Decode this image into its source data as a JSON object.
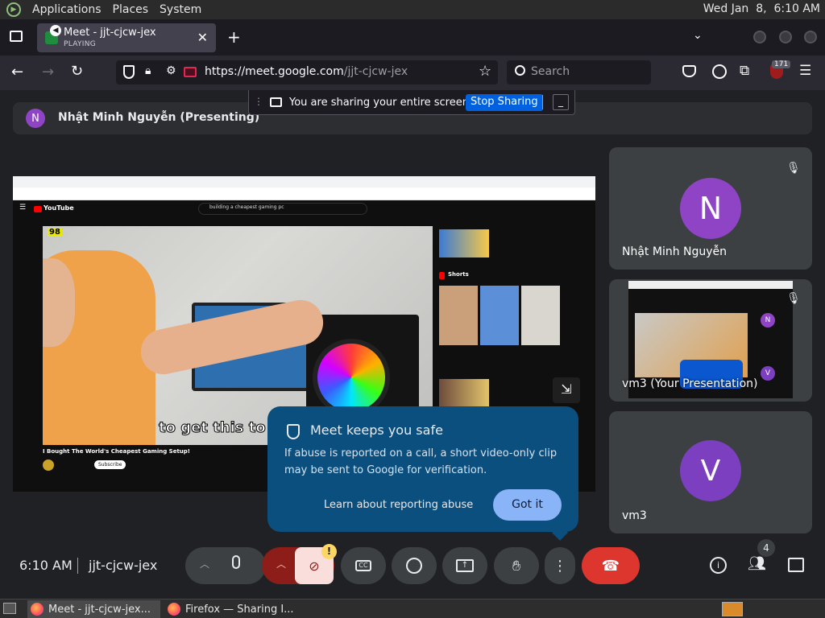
{
  "top_panel": {
    "applications": "Applications",
    "places": "Places",
    "system": "System",
    "clock": "Wed Jan  8,  6:10 AM"
  },
  "browser": {
    "tab": {
      "title": "Meet - jjt-cjcw-jex",
      "status": "PLAYING"
    },
    "url_host": "https://meet.google.com",
    "url_path": "/jjt-cjcw-jex",
    "search_placeholder": "Search",
    "extension_badge": "171",
    "sharing_bar": {
      "message": "You are sharing your entire screen.",
      "stop_label": "Stop Sharing"
    }
  },
  "meet": {
    "presenter": {
      "initial": "N",
      "label": "Nhật Minh Nguyễn (Presenting)"
    },
    "shared_screen": {
      "youtube_logo": "YouTube",
      "search_query": "building a cheapest gaming pc",
      "caption": "to get this to",
      "video_title": "I Bought The World's Cheapest Gaming Setup!",
      "subscribe": "Subscribe",
      "shorts_label": "Shorts",
      "video_counter": "98"
    },
    "participants": [
      {
        "initial": "N",
        "name": "Nhật Minh Nguyễn",
        "color": "#8e44c4"
      },
      {
        "name": "vm3 (Your Presentation)"
      },
      {
        "initial": "V",
        "name": "vm3",
        "color": "#7b3fbf"
      }
    ],
    "popup": {
      "title": "Meet keeps you safe",
      "body": "If abuse is reported on a call, a short video-only clip may be sent to Google for verification.",
      "learn": "Learn about reporting abuse",
      "ok": "Got it"
    },
    "bottom_bar": {
      "time": "6:10 AM",
      "meeting_code": "jjt-cjcw-jex",
      "people_count": "4",
      "alert_mark": "!"
    },
    "colors": {
      "accent": "#8ab4f8",
      "hangup": "#ea4335",
      "popup_bg": "#0b57d0",
      "muted_red": "#8c1d18"
    }
  },
  "taskbar": {
    "task1": "Meet - jjt-cjcw-jex...",
    "task2": "Firefox — Sharing I..."
  }
}
